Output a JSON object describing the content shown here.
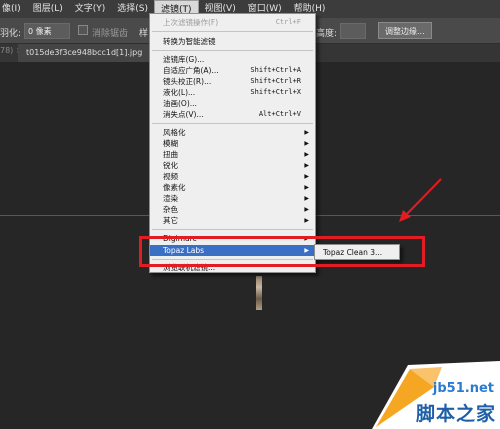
{
  "menubar": [
    "像(I)",
    "图层(L)",
    "文字(Y)",
    "选择(S)",
    "滤镜(T)",
    "视图(V)",
    "窗口(W)",
    "帮助(H)"
  ],
  "options": {
    "feather_label": "羽化:",
    "feather_value": "0 像素",
    "antialias_label": "消除锯齿",
    "style_label": "样",
    "height_label": "高度:",
    "refine_button": "调整边缘..."
  },
  "tabs": {
    "prev": "78) ×",
    "active": "t015de3f3ce948bcc1d[1].jpg"
  },
  "filter_menu": {
    "last_filter": "上次滤镜操作(F)",
    "last_filter_shortcut": "Ctrl+F",
    "convert_smart": "转换为智能滤镜",
    "gallery": "滤镜库(G)...",
    "adaptive_wide": "自适应广角(A)...",
    "adaptive_wide_shortcut": "Shift+Ctrl+A",
    "lens_correction": "镜头校正(R)...",
    "lens_correction_shortcut": "Shift+Ctrl+R",
    "liquify": "液化(L)...",
    "liquify_shortcut": "Shift+Ctrl+X",
    "oil_paint": "油画(O)...",
    "vanishing_point": "消失点(V)...",
    "vanishing_point_shortcut": "Alt+Ctrl+V",
    "stylize": "风格化",
    "blur": "模糊",
    "distort": "扭曲",
    "sharpen": "锐化",
    "video": "视频",
    "pixelate": "像素化",
    "render": "渲染",
    "noise": "杂色",
    "other": "其它",
    "digimarc": "Digimarc",
    "topaz": "Topaz Labs",
    "browse_online": "浏览联机滤镜..."
  },
  "topaz_submenu": {
    "item": "Topaz Clean 3..."
  },
  "watermark": {
    "site": "jb51.net",
    "name": "脚本之家"
  },
  "colors": {
    "highlight": "#3a6fc6",
    "annotation_red": "#e31b23"
  }
}
